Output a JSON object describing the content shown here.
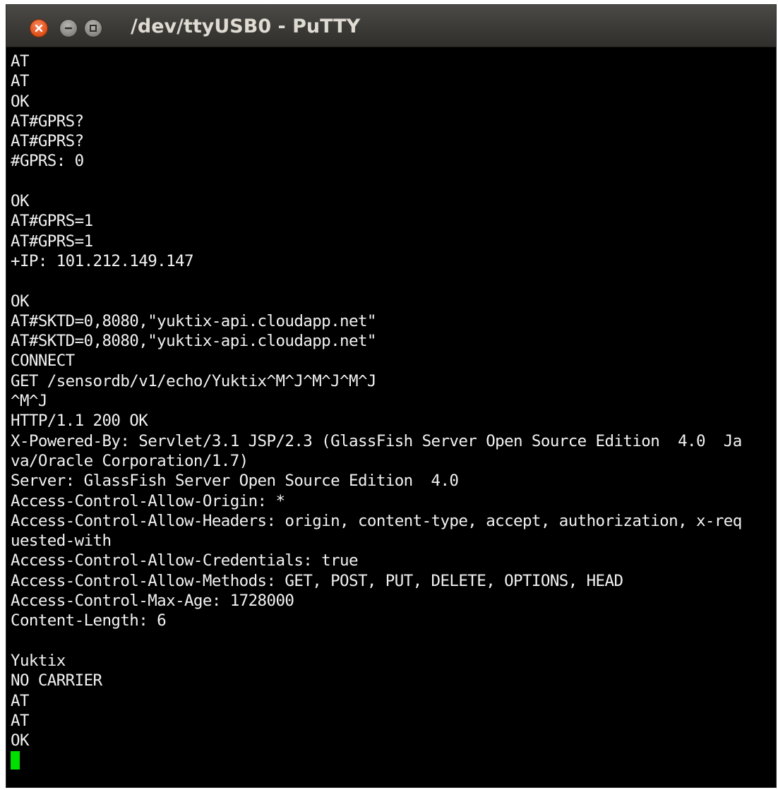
{
  "window": {
    "title": "/dev/ttyUSB0 - PuTTY",
    "controls": {
      "close": "close-icon",
      "minimize": "minimize-icon",
      "maximize": "maximize-icon"
    }
  },
  "terminal": {
    "foreground": "#f2f2f2",
    "background": "#000000",
    "cursor_color": "#00e000",
    "lines": [
      "AT",
      "AT",
      "OK",
      "AT#GPRS?",
      "AT#GPRS?",
      "#GPRS: 0",
      "",
      "OK",
      "AT#GPRS=1",
      "AT#GPRS=1",
      "+IP: 101.212.149.147",
      "",
      "OK",
      "AT#SKTD=0,8080,\"yuktix-api.cloudapp.net\"",
      "AT#SKTD=0,8080,\"yuktix-api.cloudapp.net\"",
      "CONNECT",
      "GET /sensordb/v1/echo/Yuktix^M^J^M^J^M^J",
      "^M^J",
      "HTTP/1.1 200 OK",
      "X-Powered-By: Servlet/3.1 JSP/2.3 (GlassFish Server Open Source Edition  4.0  Ja",
      "va/Oracle Corporation/1.7)",
      "Server: GlassFish Server Open Source Edition  4.0",
      "Access-Control-Allow-Origin: *",
      "Access-Control-Allow-Headers: origin, content-type, accept, authorization, x-req",
      "uested-with",
      "Access-Control-Allow-Credentials: true",
      "Access-Control-Allow-Methods: GET, POST, PUT, DELETE, OPTIONS, HEAD",
      "Access-Control-Max-Age: 1728000",
      "Content-Length: 6",
      "",
      "Yuktix",
      "NO CARRIER",
      "AT",
      "AT",
      "OK"
    ]
  }
}
